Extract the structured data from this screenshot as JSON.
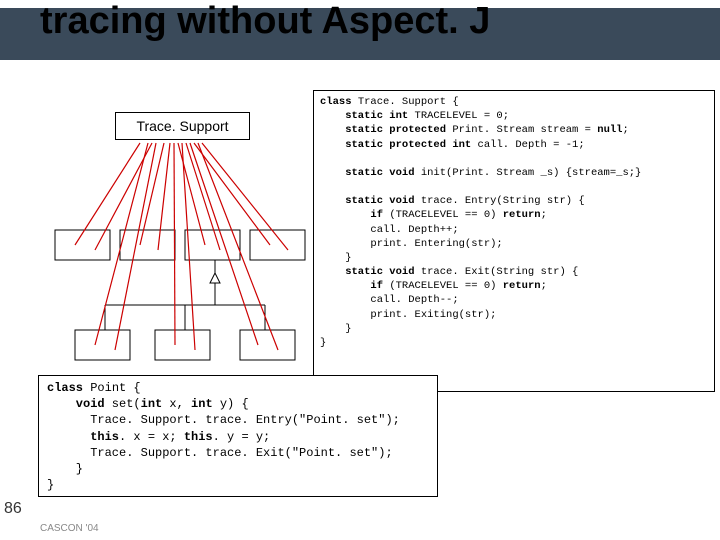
{
  "title": "tracing without Aspect. J",
  "trace_label": "Trace. Support",
  "code_right": {
    "l1a": "class",
    "l1b": " Trace. Support {",
    "l2a": "    static int",
    "l2b": " TRACELEVEL = 0;",
    "l3a": "    static protected",
    "l3b": " Print. Stream stream = ",
    "l3c": "null",
    "l3d": ";",
    "l4a": "    static protected int",
    "l4b": " call. Depth = -1;",
    "l5": " ",
    "l6a": "    static void",
    "l6b": " init(Print. Stream _s) {stream=_s;}",
    "l7": " ",
    "l8a": "    static void",
    "l8b": " trace. Entry(String str) {",
    "l9a": "        if",
    "l9b": " (TRACELEVEL == 0) ",
    "l9c": "return",
    "l9d": ";",
    "l10": "        call. Depth++;",
    "l11": "        print. Entering(str);",
    "l12": "    }",
    "l13a": "    static void",
    "l13b": " trace. Exit(String str) {",
    "l14a": "        if",
    "l14b": " (TRACELEVEL == 0) ",
    "l14c": "return",
    "l14d": ";",
    "l15": "        call. Depth--;",
    "l16": "        print. Exiting(str);",
    "l17": "    }",
    "l18": "}"
  },
  "code_left": {
    "l1a": "class",
    "l1b": " Point {",
    "l2a": "    void",
    "l2b": " set(",
    "l2c": "int",
    "l2d": " x, ",
    "l2e": "int",
    "l2f": " y) {",
    "l3": "      Trace. Support. trace. Entry(\"Point. set\");",
    "l4a": "      this",
    "l4b": ". x = x; ",
    "l4c": "this",
    "l4d": ". y = y;",
    "l5": "      Trace. Support. trace. Exit(\"Point. set\");",
    "l6": "    }",
    "l7": "}"
  },
  "page_num": "86",
  "footer": "CASCON '04"
}
